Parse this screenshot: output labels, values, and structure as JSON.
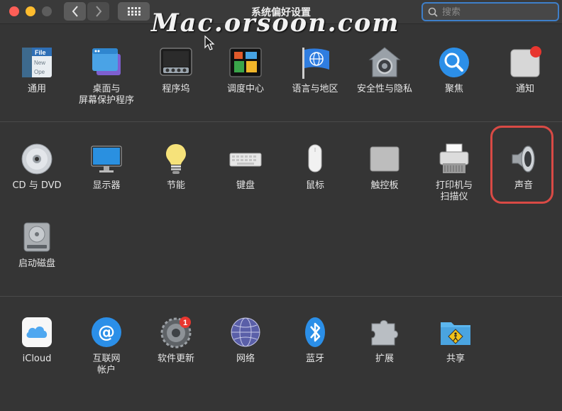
{
  "window": {
    "title": "系统偏好设置",
    "traffic_lights": {
      "close": "#fe5f57",
      "minimize": "#febc2e",
      "zoom": "#5d5d5d"
    }
  },
  "search": {
    "placeholder": "搜索",
    "value": ""
  },
  "watermark": "Mac.orsoon.com",
  "sections": [
    {
      "items": [
        {
          "name": "general",
          "label": "通用",
          "icon": "general-icon"
        },
        {
          "name": "desktop-screensaver",
          "label": "桌面与\n屏幕保护程序",
          "icon": "desktop-icon"
        },
        {
          "name": "dock",
          "label": "程序坞",
          "icon": "dock-icon"
        },
        {
          "name": "mission-control",
          "label": "调度中心",
          "icon": "mission-control-icon"
        },
        {
          "name": "language-region",
          "label": "语言与地区",
          "icon": "globe-flag-icon"
        },
        {
          "name": "security-privacy",
          "label": "安全性与隐私",
          "icon": "house-lock-icon"
        },
        {
          "name": "spotlight",
          "label": "聚焦",
          "icon": "magnifier-icon"
        },
        {
          "name": "notifications",
          "label": "通知",
          "icon": "notification-icon"
        }
      ]
    },
    {
      "items": [
        {
          "name": "cd-dvd",
          "label": "CD 与 DVD",
          "icon": "disc-icon"
        },
        {
          "name": "displays",
          "label": "显示器",
          "icon": "monitor-icon"
        },
        {
          "name": "energy-saver",
          "label": "节能",
          "icon": "lightbulb-icon"
        },
        {
          "name": "keyboard",
          "label": "键盘",
          "icon": "keyboard-icon"
        },
        {
          "name": "mouse",
          "label": "鼠标",
          "icon": "mouse-icon"
        },
        {
          "name": "trackpad",
          "label": "触控板",
          "icon": "trackpad-icon"
        },
        {
          "name": "printers-scanners",
          "label": "打印机与\n扫描仪",
          "icon": "printer-icon"
        },
        {
          "name": "sound",
          "label": "声音",
          "icon": "speaker-icon",
          "highlighted": true
        },
        {
          "name": "startup-disk",
          "label": "启动磁盘",
          "icon": "hard-drive-icon"
        }
      ]
    },
    {
      "items": [
        {
          "name": "icloud",
          "label": "iCloud",
          "icon": "cloud-icon"
        },
        {
          "name": "internet-accounts",
          "label": "互联网\n帐户",
          "icon": "at-sign-icon"
        },
        {
          "name": "software-update",
          "label": "软件更新",
          "icon": "gear-update-icon",
          "badge": "1"
        },
        {
          "name": "network",
          "label": "网络",
          "icon": "network-globe-icon"
        },
        {
          "name": "bluetooth",
          "label": "蓝牙",
          "icon": "bluetooth-icon"
        },
        {
          "name": "extensions",
          "label": "扩展",
          "icon": "puzzle-icon"
        },
        {
          "name": "sharing",
          "label": "共享",
          "icon": "sharing-folder-icon"
        }
      ]
    }
  ],
  "colors": {
    "background": "#353535",
    "highlight_ring": "#d94a45",
    "search_focus": "#3e7fc9",
    "badge": "#e8362f"
  }
}
